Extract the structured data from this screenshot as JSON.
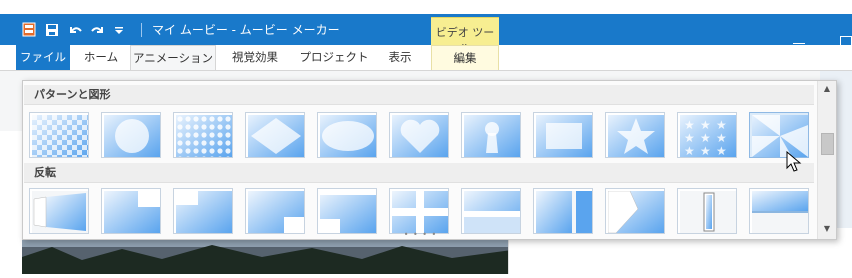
{
  "window": {
    "title": "マイ ムービー - ムービー メーカー",
    "context_tab_group": "ビデオ ツール"
  },
  "tabs": {
    "file": "ファイル",
    "home": "ホーム",
    "animation": "アニメーション",
    "visual_effects": "視覚効果",
    "project": "プロジェクト",
    "view": "表示",
    "edit": "編集"
  },
  "gallery": {
    "section1_label": "パターンと図形",
    "section2_label": "反転",
    "patterns": [
      "checkerboard-icon",
      "circle-icon",
      "dots-icon",
      "diamond-icon",
      "ellipse-icon",
      "heart-icon",
      "keyhole-icon",
      "rectangle-icon",
      "star-icon",
      "stars-icon",
      "pinwheel-icon"
    ],
    "flips": [
      "flip-left-icon",
      "slide-tr-icon",
      "slide-tl-icon",
      "slide-br-icon",
      "slide-bl-icon",
      "cross-icon",
      "bar-icon",
      "slide-right-icon",
      "fold-icon",
      "vertical-bar-icon",
      "top-bar-icon"
    ],
    "selected_index": 10
  },
  "colors": {
    "title_bar": "#1979ca",
    "context_tab": "#f7ee91",
    "accent_blue": "#6aaef0"
  }
}
